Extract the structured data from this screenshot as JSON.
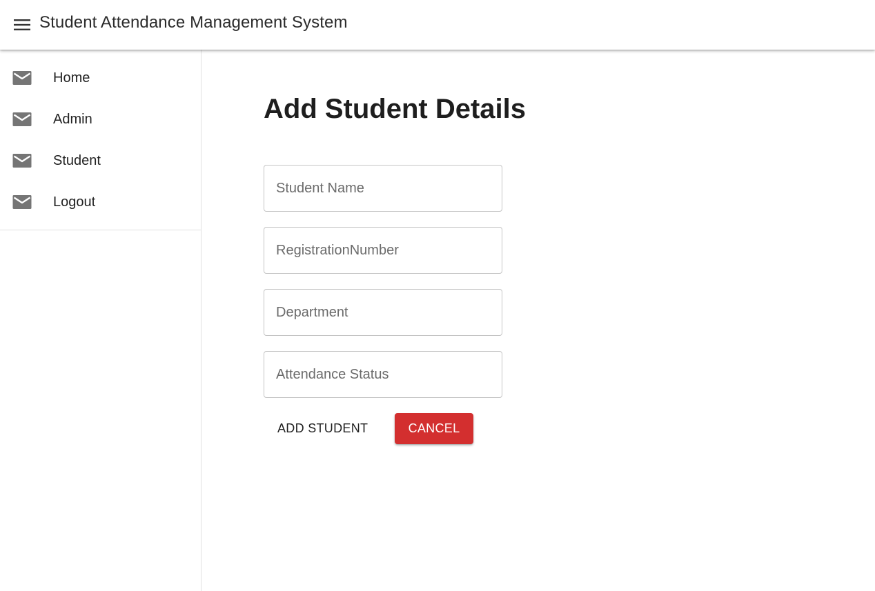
{
  "appbar": {
    "title": "Student Attendance Management System",
    "menu_icon": "hamburger-menu-icon"
  },
  "drawer": {
    "items": [
      {
        "label": "Home",
        "icon": "mail-icon"
      },
      {
        "label": "Admin",
        "icon": "mail-icon"
      },
      {
        "label": "Student",
        "icon": "mail-icon"
      },
      {
        "label": "Logout",
        "icon": "mail-icon"
      }
    ]
  },
  "form": {
    "title": "Add Student Details",
    "fields": [
      {
        "placeholder": "Student Name",
        "value": ""
      },
      {
        "placeholder": "RegistrationNumber",
        "value": ""
      },
      {
        "placeholder": "Department",
        "value": ""
      },
      {
        "placeholder": "Attendance Status",
        "value": ""
      }
    ],
    "add_label": "ADD STUDENT",
    "cancel_label": "CANCEL"
  },
  "colors": {
    "cancel_bg": "#d32f2f",
    "icon_gray": "#757575",
    "divider": "#e0e0e0"
  }
}
